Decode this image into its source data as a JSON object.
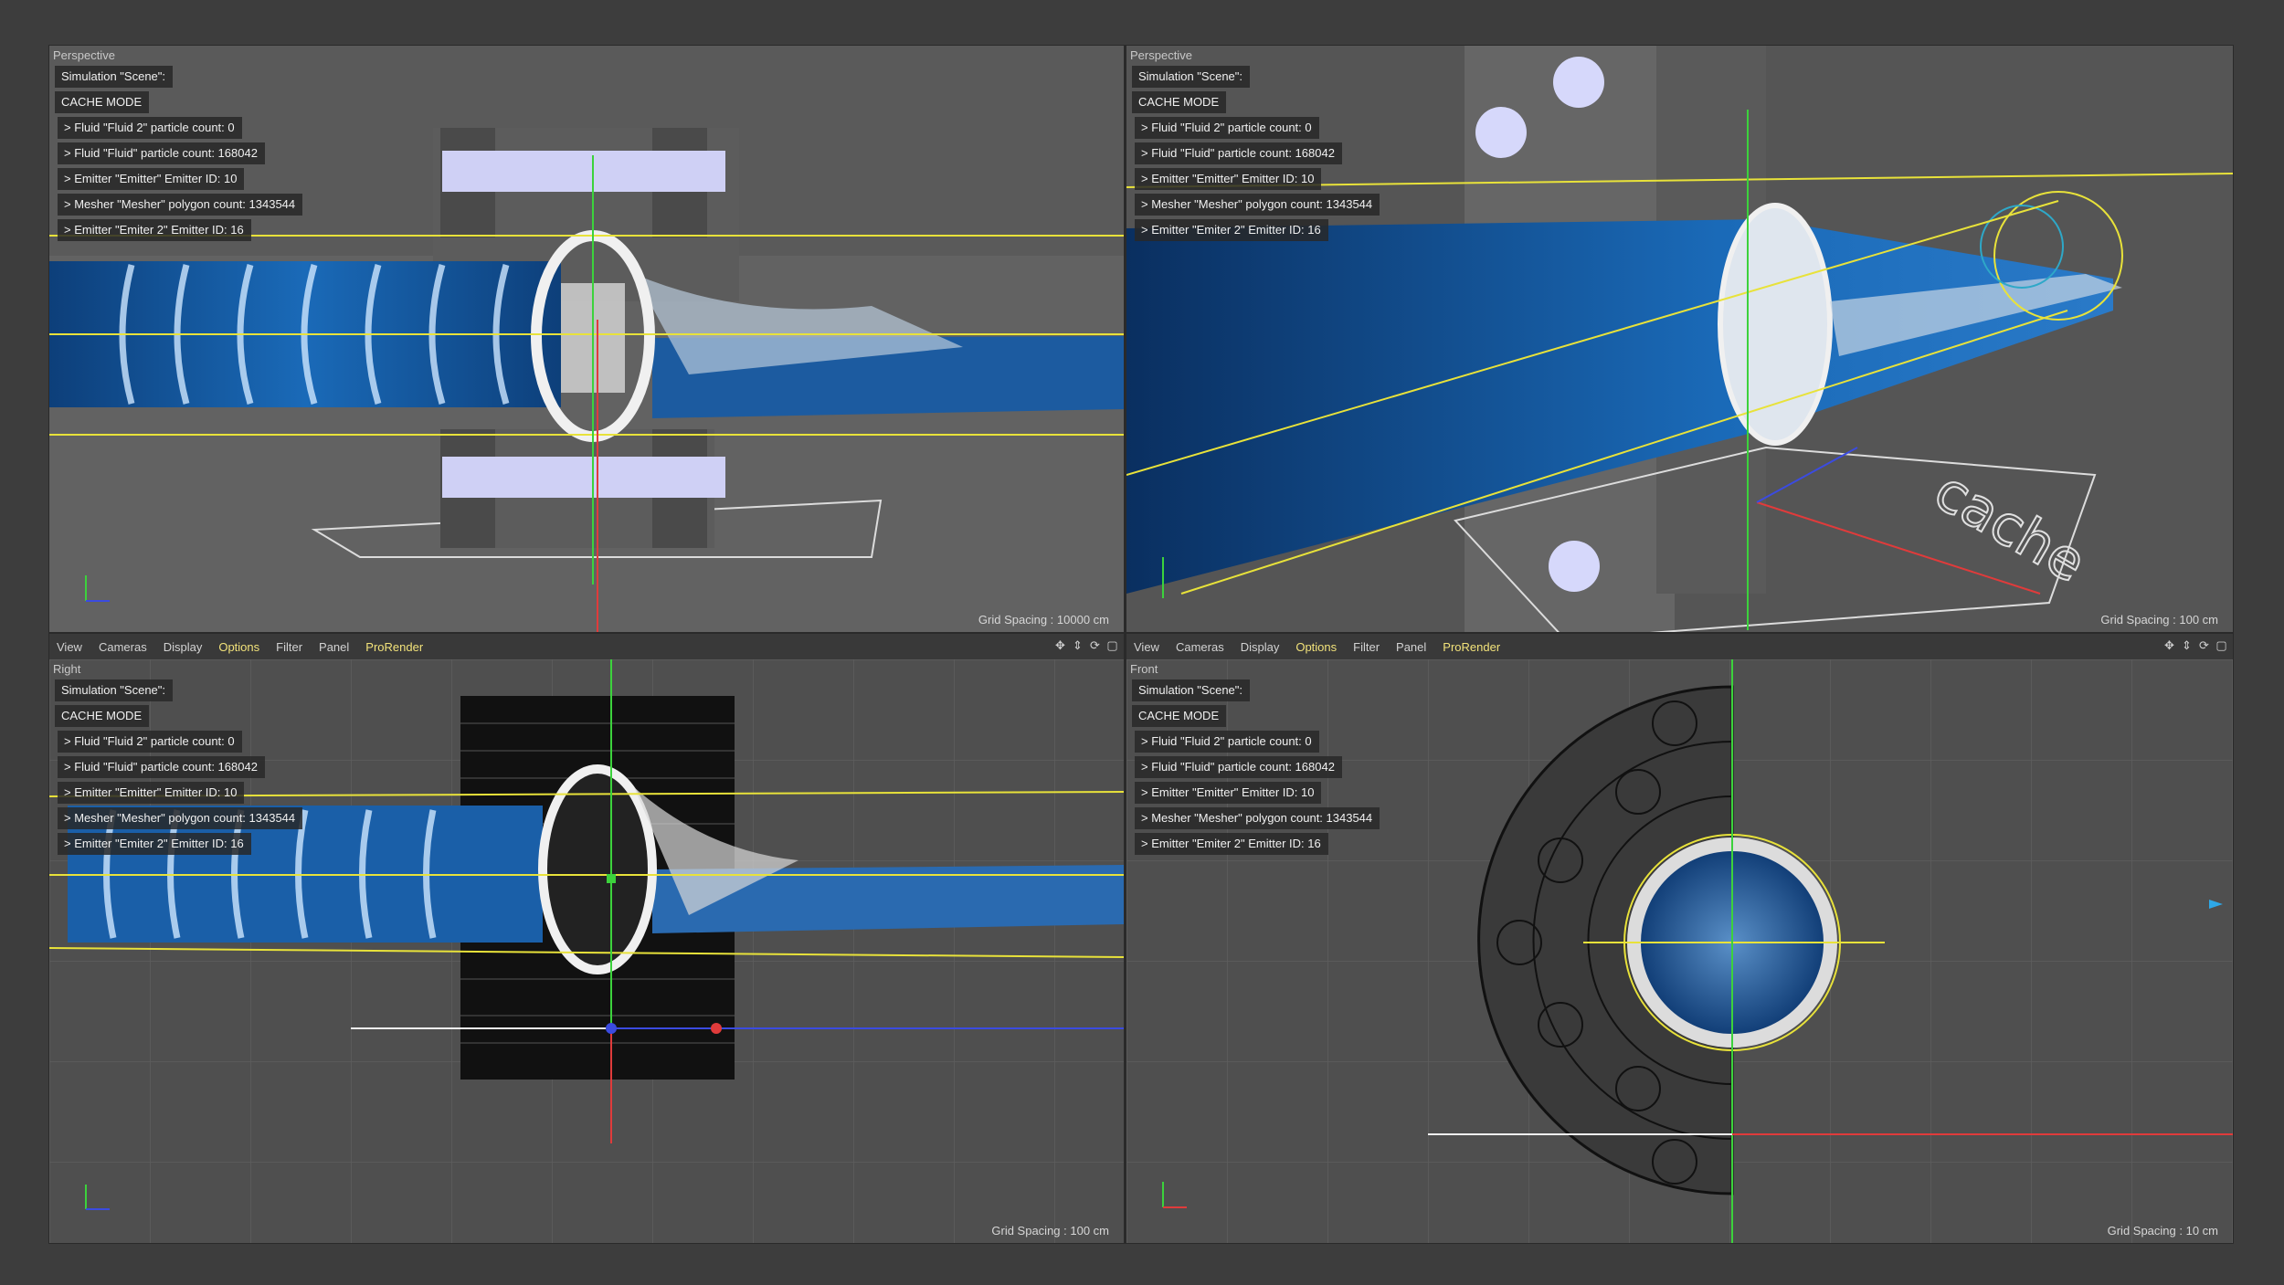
{
  "viewports": [
    {
      "name": "perspective-left",
      "title": "Perspective",
      "grid_spacing": "Grid Spacing : 10000 cm",
      "info": [
        "Simulation \"Scene\":",
        "CACHE MODE",
        "> Fluid \"Fluid 2\" particle count: 0",
        "> Fluid \"Fluid\" particle count: 168042",
        "> Emitter \"Emitter\" Emitter ID: 10",
        "> Mesher \"Mesher\" polygon count: 1343544",
        "> Emitter \"Emiter 2\" Emitter ID: 16"
      ]
    },
    {
      "name": "perspective-right",
      "title": "Perspective",
      "grid_spacing": "Grid Spacing : 100 cm",
      "info": [
        "Simulation \"Scene\":",
        "CACHE MODE",
        "> Fluid \"Fluid 2\" particle count: 0",
        "> Fluid \"Fluid\" particle count: 168042",
        "> Emitter \"Emitter\" Emitter ID: 10",
        "> Mesher \"Mesher\" polygon count: 1343544",
        "> Emitter \"Emiter 2\" Emitter ID: 16"
      ]
    },
    {
      "name": "right-view",
      "title": "Right",
      "grid_spacing": "Grid Spacing : 100 cm",
      "info": [
        "Simulation \"Scene\":",
        "CACHE MODE",
        "> Fluid \"Fluid 2\" particle count: 0",
        "> Fluid \"Fluid\" particle count: 168042",
        "> Emitter \"Emitter\" Emitter ID: 10",
        "> Mesher \"Mesher\" polygon count: 1343544",
        "> Emitter \"Emiter 2\" Emitter ID: 16"
      ]
    },
    {
      "name": "front-view",
      "title": "Front",
      "grid_spacing": "Grid Spacing : 10 cm",
      "info": [
        "Simulation \"Scene\":",
        "CACHE MODE",
        "> Fluid \"Fluid 2\" particle count: 0",
        "> Fluid \"Fluid\" particle count: 168042",
        "> Emitter \"Emitter\" Emitter ID: 10",
        "> Mesher \"Mesher\" polygon count: 1343544",
        "> Emitter \"Emiter 2\" Emitter ID: 16"
      ]
    }
  ],
  "toolbar": {
    "menus": [
      "View",
      "Cameras",
      "Display",
      "Options",
      "Filter",
      "Panel",
      "ProRender"
    ],
    "active": [
      "Options",
      "ProRender"
    ]
  },
  "scene_text": {
    "logo_word": "cache"
  },
  "colors": {
    "viewport_bg": "#4f4f4f",
    "fluid_blue": "#1a5fa8",
    "accent_yellow": "#e8e23a",
    "axis_green": "#3cd23c",
    "axis_red": "#e03b3b",
    "axis_blue": "#3b4be0",
    "active_menu": "#f2e27a"
  }
}
